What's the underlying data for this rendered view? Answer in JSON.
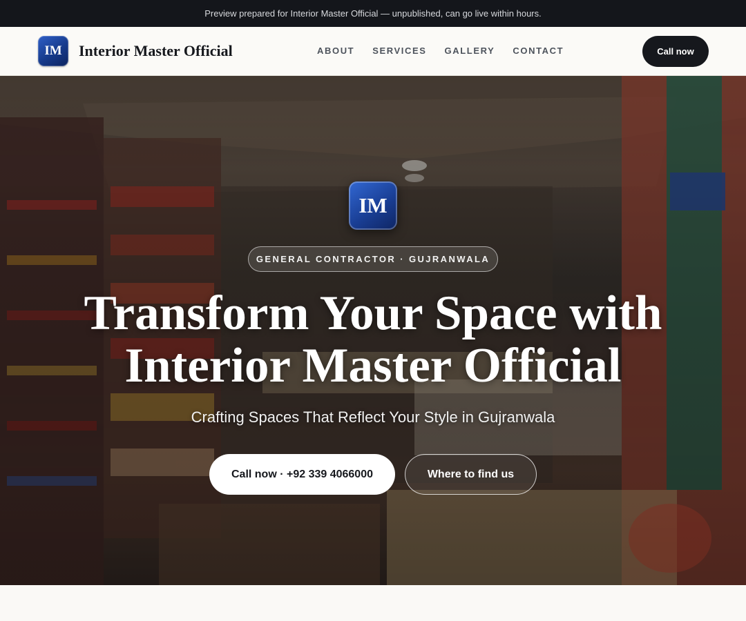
{
  "preview_bar": {
    "text": "Preview prepared for Interior Master Official — unpublished, can go live within hours."
  },
  "header": {
    "logo_initials": "IM",
    "brand_name": "Interior Master Official",
    "nav": [
      {
        "label": "ABOUT"
      },
      {
        "label": "SERVICES"
      },
      {
        "label": "GALLERY"
      },
      {
        "label": "CONTACT"
      }
    ],
    "cta_label": "Call now"
  },
  "hero": {
    "logo_initials": "IM",
    "badge": "GENERAL CONTRACTOR · GUJRANWALA",
    "title_line1": "Transform Your Space with",
    "title_line2": "Interior Master Official",
    "subtitle": "Crafting Spaces That Reflect Your Style in Gujranwala",
    "primary_button": "Call now · +92 339 4066000",
    "secondary_button": "Where to find us",
    "background_image": "shop-interior-photo"
  },
  "colors": {
    "dark": "#16181d",
    "logo_blue": "#1a3f96",
    "page_bg": "#faf9f6"
  }
}
